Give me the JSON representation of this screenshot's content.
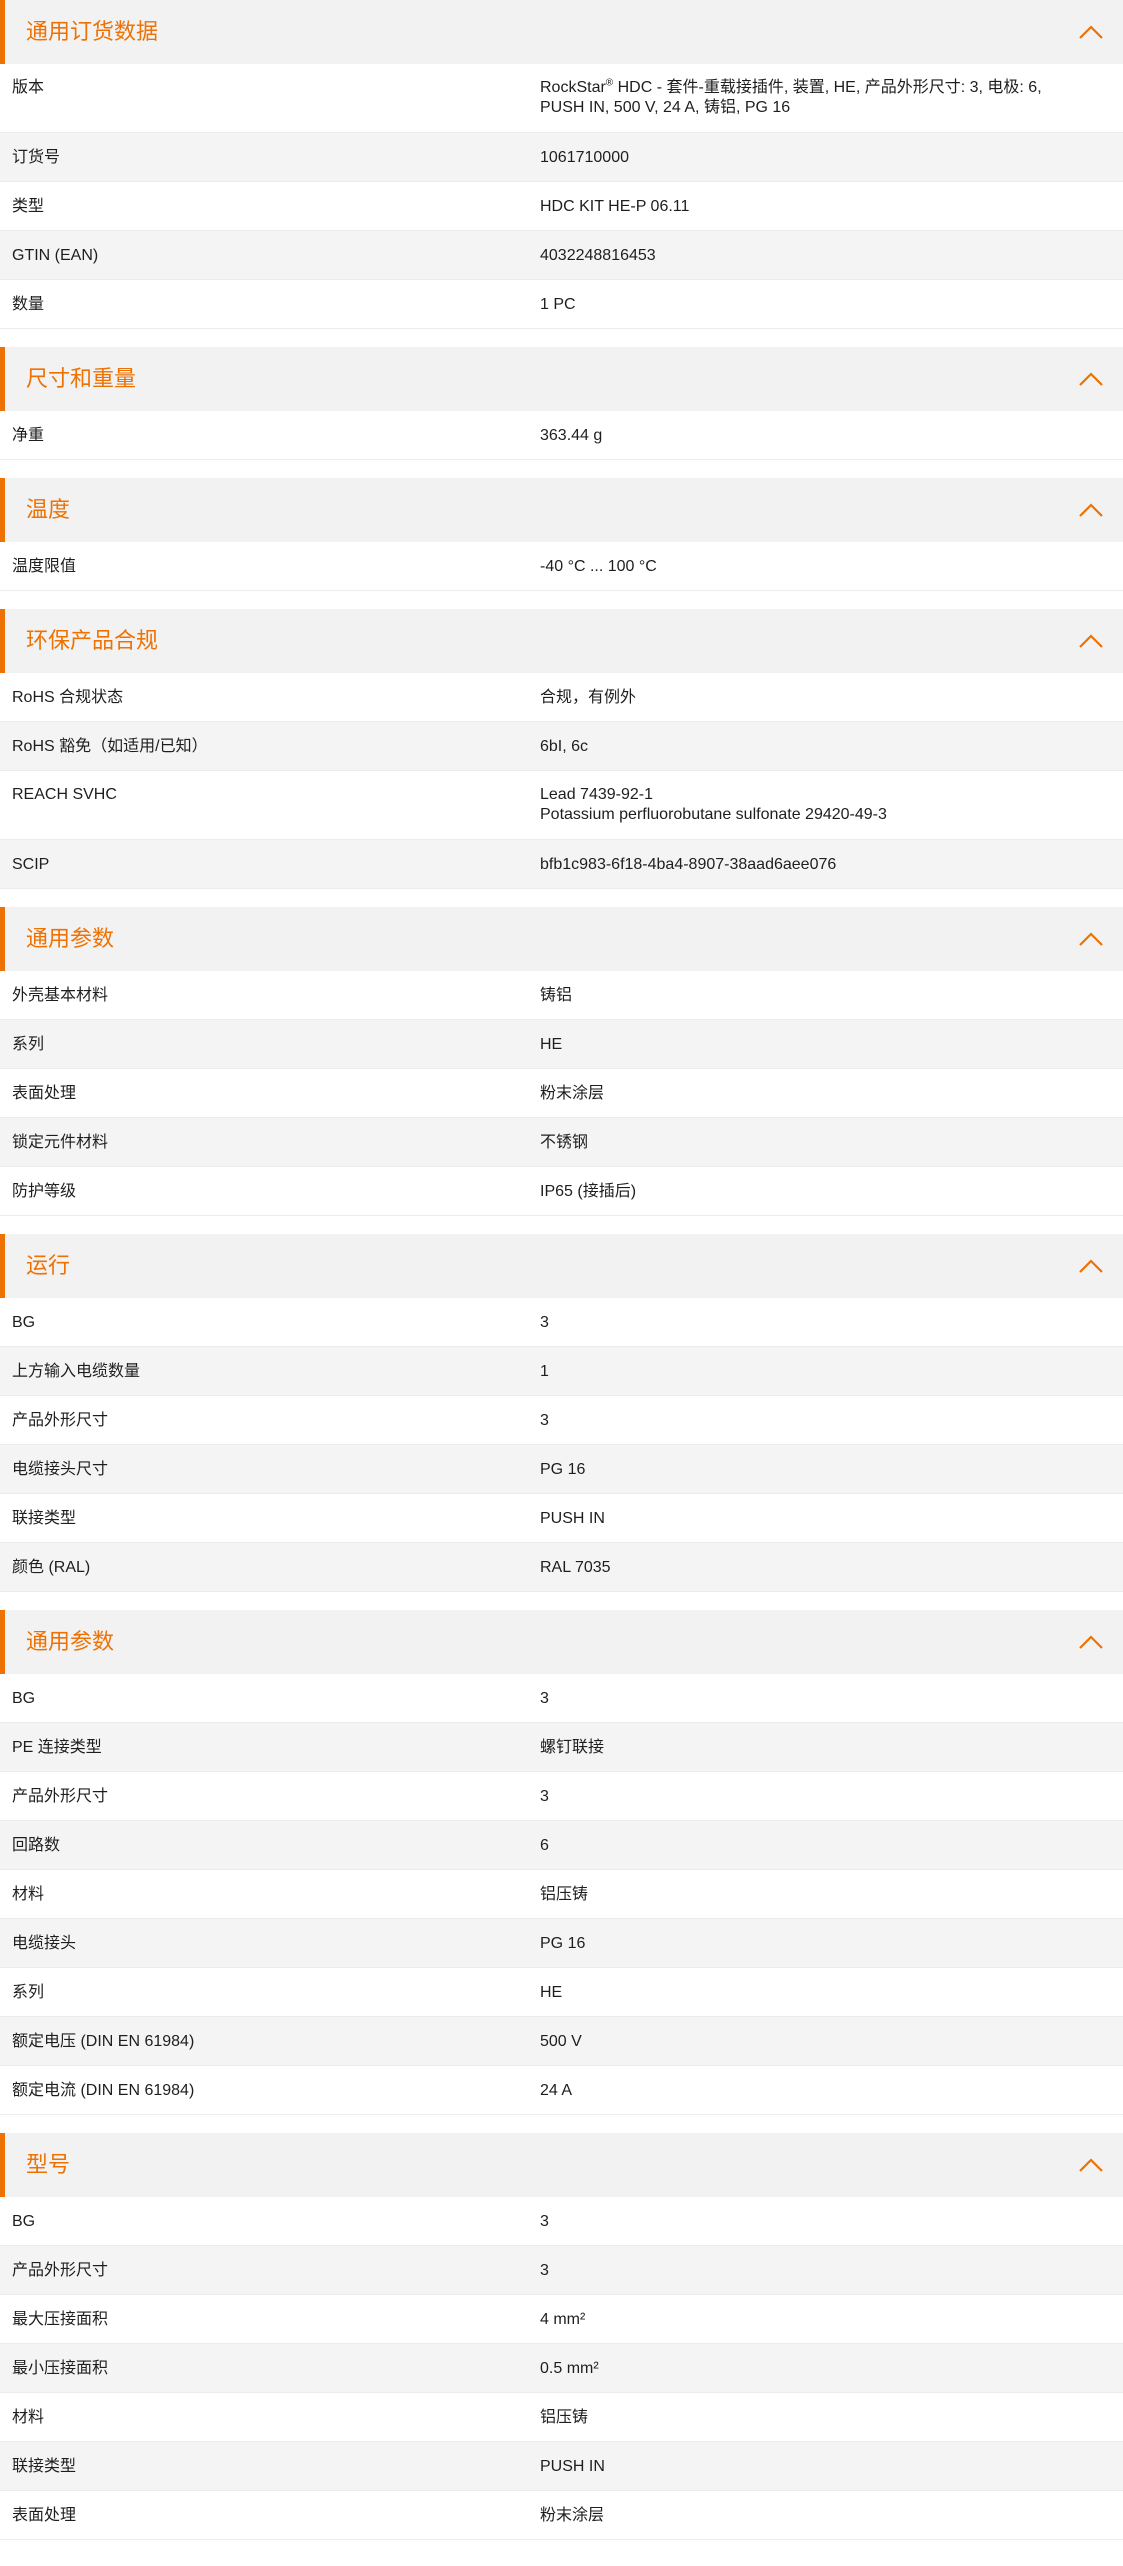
{
  "colors": {
    "accent": "#ee7203",
    "header_bg": "#f2f2f2",
    "row_alt_bg": "#f4f4f4"
  },
  "icons": {
    "collapse": "chevron-up-icon"
  },
  "sections": [
    {
      "title": "通用订货数据",
      "rows": [
        {
          "label": "版本",
          "value_lines": [
            "RockStar® HDC - 套件-重载接插件, 装置, HE, 产品外形尺寸: 3, 电极: 6,",
            "PUSH IN, 500 V, 24 A, 铸铝, PG 16"
          ]
        },
        {
          "label": "订货号",
          "value_lines": [
            "1061710000"
          ]
        },
        {
          "label": "类型",
          "value_lines": [
            "HDC KIT HE-P 06.11"
          ]
        },
        {
          "label": "GTIN (EAN)",
          "value_lines": [
            "4032248816453"
          ]
        },
        {
          "label": "数量",
          "value_lines": [
            "1  PC"
          ]
        }
      ]
    },
    {
      "title": "尺寸和重量",
      "rows": [
        {
          "label": "净重",
          "value_lines": [
            "363.44  g"
          ]
        }
      ]
    },
    {
      "title": "温度",
      "rows": [
        {
          "label": "温度限值",
          "value_lines": [
            "-40 °C ... 100 °C"
          ]
        }
      ]
    },
    {
      "title": "环保产品合规",
      "rows": [
        {
          "label": "RoHS 合规状态",
          "value_lines": [
            "合规，有例外"
          ]
        },
        {
          "label": "RoHS 豁免（如适用/已知）",
          "value_lines": [
            "6bI, 6c"
          ]
        },
        {
          "label": "REACH SVHC",
          "value_lines": [
            "Lead 7439-92-1",
            "Potassium perfluorobutane sulfonate 29420-49-3"
          ]
        },
        {
          "label": "SCIP",
          "value_lines": [
            "bfb1c983-6f18-4ba4-8907-38aad6aee076"
          ]
        }
      ]
    },
    {
      "title": "通用参数",
      "rows": [
        {
          "label": "外壳基本材料",
          "value_lines": [
            "铸铝"
          ]
        },
        {
          "label": "系列",
          "value_lines": [
            "HE"
          ]
        },
        {
          "label": "表面处理",
          "value_lines": [
            "粉末涂层"
          ]
        },
        {
          "label": "锁定元件材料",
          "value_lines": [
            "不锈钢"
          ]
        },
        {
          "label": "防护等级",
          "value_lines": [
            "IP65 (接插后)"
          ]
        }
      ]
    },
    {
      "title": "运行",
      "rows": [
        {
          "label": "BG",
          "value_lines": [
            "3"
          ]
        },
        {
          "label": "上方输入电缆数量",
          "value_lines": [
            "1"
          ]
        },
        {
          "label": "产品外形尺寸",
          "value_lines": [
            "3"
          ]
        },
        {
          "label": "电缆接头尺寸",
          "value_lines": [
            "PG 16"
          ]
        },
        {
          "label": "联接类型",
          "value_lines": [
            "PUSH IN"
          ]
        },
        {
          "label": "颜色 (RAL)",
          "value_lines": [
            "RAL 7035"
          ]
        }
      ]
    },
    {
      "title": "通用参数",
      "rows": [
        {
          "label": "BG",
          "value_lines": [
            "3"
          ]
        },
        {
          "label": "PE 连接类型",
          "value_lines": [
            "螺钉联接"
          ]
        },
        {
          "label": "产品外形尺寸",
          "value_lines": [
            "3"
          ]
        },
        {
          "label": "回路数",
          "value_lines": [
            "6"
          ]
        },
        {
          "label": "材料",
          "value_lines": [
            "铝压铸"
          ]
        },
        {
          "label": "电缆接头",
          "value_lines": [
            "PG 16"
          ]
        },
        {
          "label": "系列",
          "value_lines": [
            "HE"
          ]
        },
        {
          "label": "额定电压 (DIN EN 61984)",
          "value_lines": [
            "500  V"
          ]
        },
        {
          "label": "额定电流 (DIN EN 61984)",
          "value_lines": [
            "24  A"
          ]
        }
      ]
    },
    {
      "title": "型号",
      "rows": [
        {
          "label": "BG",
          "value_lines": [
            "3"
          ]
        },
        {
          "label": "产品外形尺寸",
          "value_lines": [
            "3"
          ]
        },
        {
          "label": "最大压接面积",
          "value_lines": [
            "4  mm²"
          ]
        },
        {
          "label": "最小压接面积",
          "value_lines": [
            "0.5  mm²"
          ]
        },
        {
          "label": "材料",
          "value_lines": [
            "铝压铸"
          ]
        },
        {
          "label": "联接类型",
          "value_lines": [
            "PUSH IN"
          ]
        },
        {
          "label": "表面处理",
          "value_lines": [
            "粉末涂层"
          ]
        }
      ]
    }
  ]
}
